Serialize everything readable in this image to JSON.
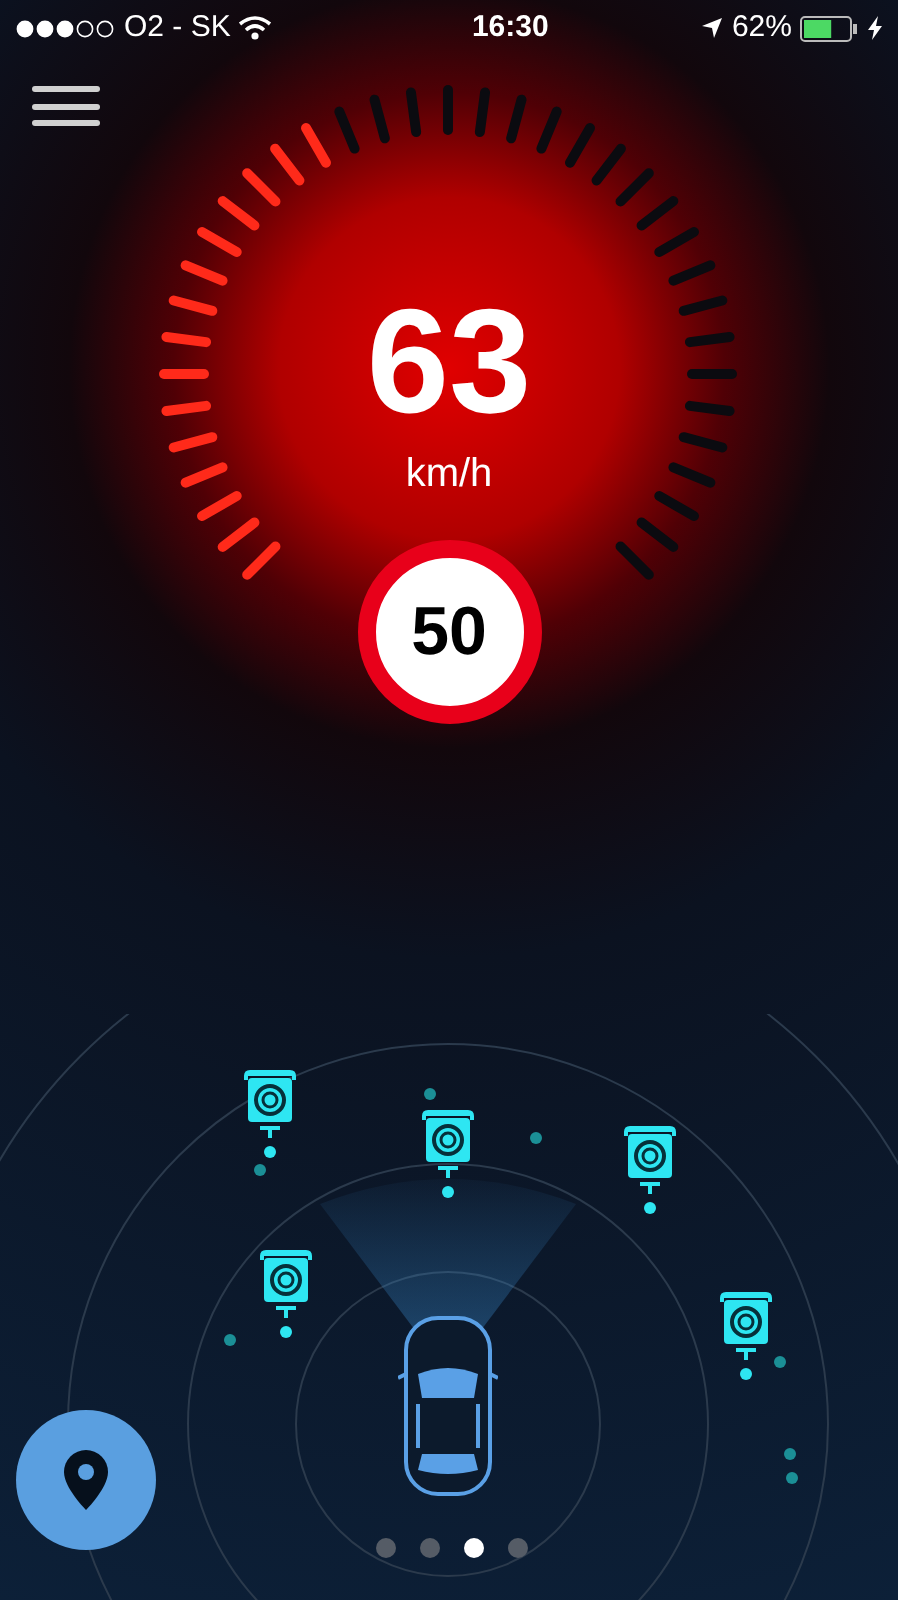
{
  "status_bar": {
    "carrier": "O2 - SK",
    "time": "16:30",
    "battery": "62%"
  },
  "speedometer": {
    "speed": "63",
    "unit": "km/h",
    "level": 0.4,
    "speed_limit": "50"
  },
  "page_dots": [
    {
      "selected": false
    },
    {
      "selected": false
    },
    {
      "selected": true
    },
    {
      "selected": false
    }
  ]
}
